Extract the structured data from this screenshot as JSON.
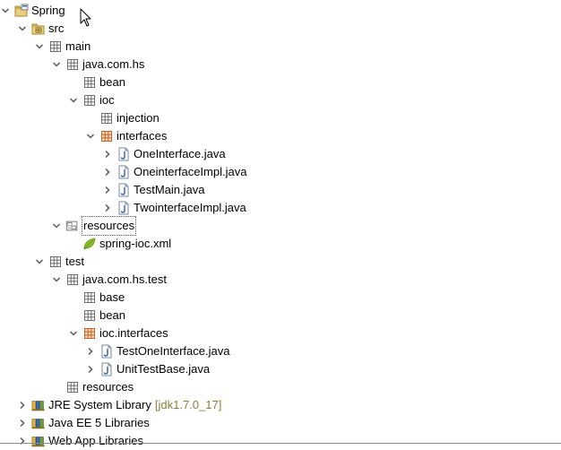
{
  "colors": {
    "twisty": "#5a5a5a",
    "package": "#6b6b6b",
    "package_full": "#c0632b",
    "java_file": "#2f5a9f",
    "xml_leaf": "#8fbf2a",
    "library": "#3f6db3",
    "decoration_text": "#8b7f3a"
  },
  "tree": [
    {
      "label": "Spring",
      "depth": 0,
      "twisty": "expanded",
      "icon": "project-icon"
    },
    {
      "label": "src",
      "depth": 1,
      "twisty": "expanded",
      "icon": "source-folder-icon"
    },
    {
      "label": "main",
      "depth": 2,
      "twisty": "expanded",
      "icon": "package-icon"
    },
    {
      "label": "java.com.hs",
      "depth": 3,
      "twisty": "expanded",
      "icon": "package-icon"
    },
    {
      "label": "bean",
      "depth": 4,
      "twisty": "none",
      "icon": "package-icon"
    },
    {
      "label": "ioc",
      "depth": 4,
      "twisty": "expanded",
      "icon": "package-icon"
    },
    {
      "label": "injection",
      "depth": 5,
      "twisty": "none",
      "icon": "package-icon"
    },
    {
      "label": "interfaces",
      "depth": 5,
      "twisty": "expanded",
      "icon": "package-full-icon"
    },
    {
      "label": "OneInterface.java",
      "depth": 6,
      "twisty": "collapsed",
      "icon": "java-file-icon"
    },
    {
      "label": "OneinterfaceImpl.java",
      "depth": 6,
      "twisty": "collapsed",
      "icon": "java-file-icon"
    },
    {
      "label": "TestMain.java",
      "depth": 6,
      "twisty": "collapsed",
      "icon": "java-file-icon"
    },
    {
      "label": "TwointerfaceImpl.java",
      "depth": 6,
      "twisty": "collapsed",
      "icon": "java-file-icon"
    },
    {
      "label": "resources",
      "depth": 3,
      "twisty": "expanded",
      "icon": "resource-folder-icon",
      "selected": true
    },
    {
      "label": "spring-ioc.xml",
      "depth": 4,
      "twisty": "none",
      "icon": "xml-leaf-icon"
    },
    {
      "label": "test",
      "depth": 2,
      "twisty": "expanded",
      "icon": "package-icon"
    },
    {
      "label": "java.com.hs.test",
      "depth": 3,
      "twisty": "expanded",
      "icon": "package-icon"
    },
    {
      "label": "base",
      "depth": 4,
      "twisty": "none",
      "icon": "package-icon"
    },
    {
      "label": "bean",
      "depth": 4,
      "twisty": "none",
      "icon": "package-icon"
    },
    {
      "label": "ioc.interfaces",
      "depth": 4,
      "twisty": "expanded",
      "icon": "package-full-icon"
    },
    {
      "label": "TestOneInterface.java",
      "depth": 5,
      "twisty": "collapsed",
      "icon": "java-file-icon"
    },
    {
      "label": "UnitTestBase.java",
      "depth": 5,
      "twisty": "collapsed",
      "icon": "java-file-icon"
    },
    {
      "label": "resources",
      "depth": 3,
      "twisty": "none",
      "icon": "package-icon"
    },
    {
      "label": "JRE System Library",
      "depth": 1,
      "twisty": "collapsed",
      "icon": "library-icon",
      "decoration": "[jdk1.7.0_17]"
    },
    {
      "label": "Java EE 5 Libraries",
      "depth": 1,
      "twisty": "collapsed",
      "icon": "library-icon"
    },
    {
      "label": "Web App Libraries",
      "depth": 1,
      "twisty": "collapsed",
      "icon": "library-icon"
    }
  ]
}
